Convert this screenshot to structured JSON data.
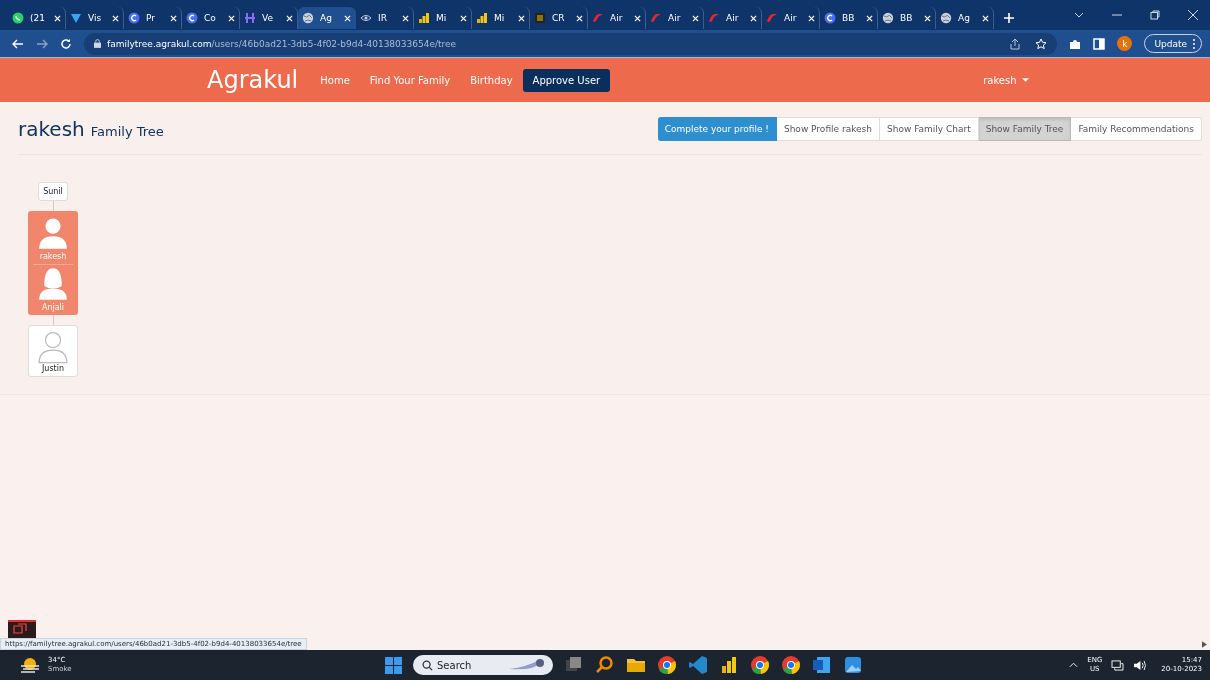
{
  "browser": {
    "tabs": [
      {
        "label": "(21",
        "selected": false
      },
      {
        "label": "Vis",
        "selected": false
      },
      {
        "label": "Pr",
        "selected": false
      },
      {
        "label": "Co",
        "selected": false
      },
      {
        "label": "Ve",
        "selected": false
      },
      {
        "label": "Ag",
        "selected": true
      },
      {
        "label": "IR",
        "selected": false
      },
      {
        "label": "Mi",
        "selected": false
      },
      {
        "label": "Mi",
        "selected": false
      },
      {
        "label": "CR",
        "selected": false
      },
      {
        "label": "Air",
        "selected": false
      },
      {
        "label": "Air",
        "selected": false
      },
      {
        "label": "Air",
        "selected": false
      },
      {
        "label": "Air",
        "selected": false
      },
      {
        "label": "BB",
        "selected": false
      },
      {
        "label": "BB",
        "selected": false
      },
      {
        "label": "Ag",
        "selected": false
      }
    ],
    "address": {
      "host": "familytree.agrakul.com",
      "path": "/users/46b0ad21-3db5-4f02-b9d4-40138033654e/tree"
    },
    "profile_initial": "k",
    "update_button": "Update"
  },
  "navbar": {
    "brand": "Agrakul",
    "links": [
      {
        "label": "Home",
        "selected": false
      },
      {
        "label": "Find Your Family",
        "selected": false
      },
      {
        "label": "Birthday",
        "selected": false
      },
      {
        "label": "Approve User",
        "selected": true
      }
    ],
    "user_menu": "rakesh"
  },
  "page": {
    "title_name": "rakesh",
    "title_suffix": "Family Tree",
    "actions": [
      {
        "label": "Complete your profile !",
        "kind": "primary",
        "selected": false
      },
      {
        "label": "Show Profile rakesh",
        "kind": "default",
        "selected": false
      },
      {
        "label": "Show Family Chart",
        "kind": "default",
        "selected": false
      },
      {
        "label": "Show Family Tree",
        "kind": "default",
        "selected": true
      },
      {
        "label": "Family Recommendations",
        "kind": "default",
        "selected": false
      }
    ],
    "tree": {
      "kind": "label",
      "name": "Sunil",
      "children": [
        {
          "kind": "couple",
          "members": [
            {
              "name": "rakesh",
              "kind": "male"
            },
            {
              "name": "Anjali",
              "kind": "female"
            }
          ],
          "children": [
            {
              "kind": "person",
              "name": "Justin"
            }
          ]
        }
      ]
    }
  },
  "status_link": "https://familytree.agrakul.com/users/46b0ad21-3db5-4f02-b9d4-40138033654e/tree",
  "taskbar": {
    "weather_temp": "34°C",
    "weather_text": "Smoke",
    "search_placeholder": "Search",
    "lang_top": "ENG",
    "lang_bottom": "US",
    "time": "15:47",
    "date": "20-10-2023"
  }
}
